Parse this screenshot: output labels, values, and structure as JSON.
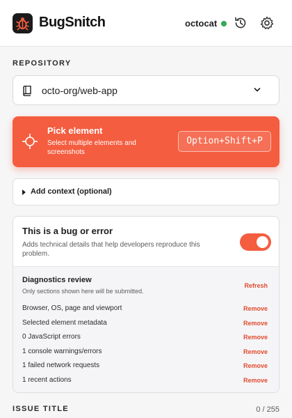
{
  "header": {
    "brand": "BugSnitch",
    "logo_icon": "bug-icon",
    "user": "octocat",
    "status_color": "#35a853",
    "history_icon": "history-icon",
    "settings_icon": "gear-icon"
  },
  "repository": {
    "label": "REPOSITORY",
    "value": "octo-org/web-app",
    "icon": "repo-book-icon"
  },
  "pick": {
    "title": "Pick element",
    "description": "Select multiple elements and screenshots",
    "shortcut": "Option+Shift+P",
    "icon": "crosshair-icon",
    "accent": "#f45d3f"
  },
  "context": {
    "label": "Add context (optional)"
  },
  "bug": {
    "title": "This is a bug or error",
    "description": "Adds technical details that help developers reproduce this problem.",
    "enabled": true
  },
  "diagnostics": {
    "title": "Diagnostics review",
    "subtitle": "Only sections shown here will be submitted.",
    "refresh_label": "Refresh",
    "remove_label": "Remove",
    "items": [
      "Browser, OS, page and viewport",
      "Selected element metadata",
      "0 JavaScript errors",
      "1 console warnings/errors",
      "1 failed network requests",
      "1 recent actions"
    ]
  },
  "issue": {
    "label": "ISSUE TITLE",
    "count": "0 / 255"
  }
}
